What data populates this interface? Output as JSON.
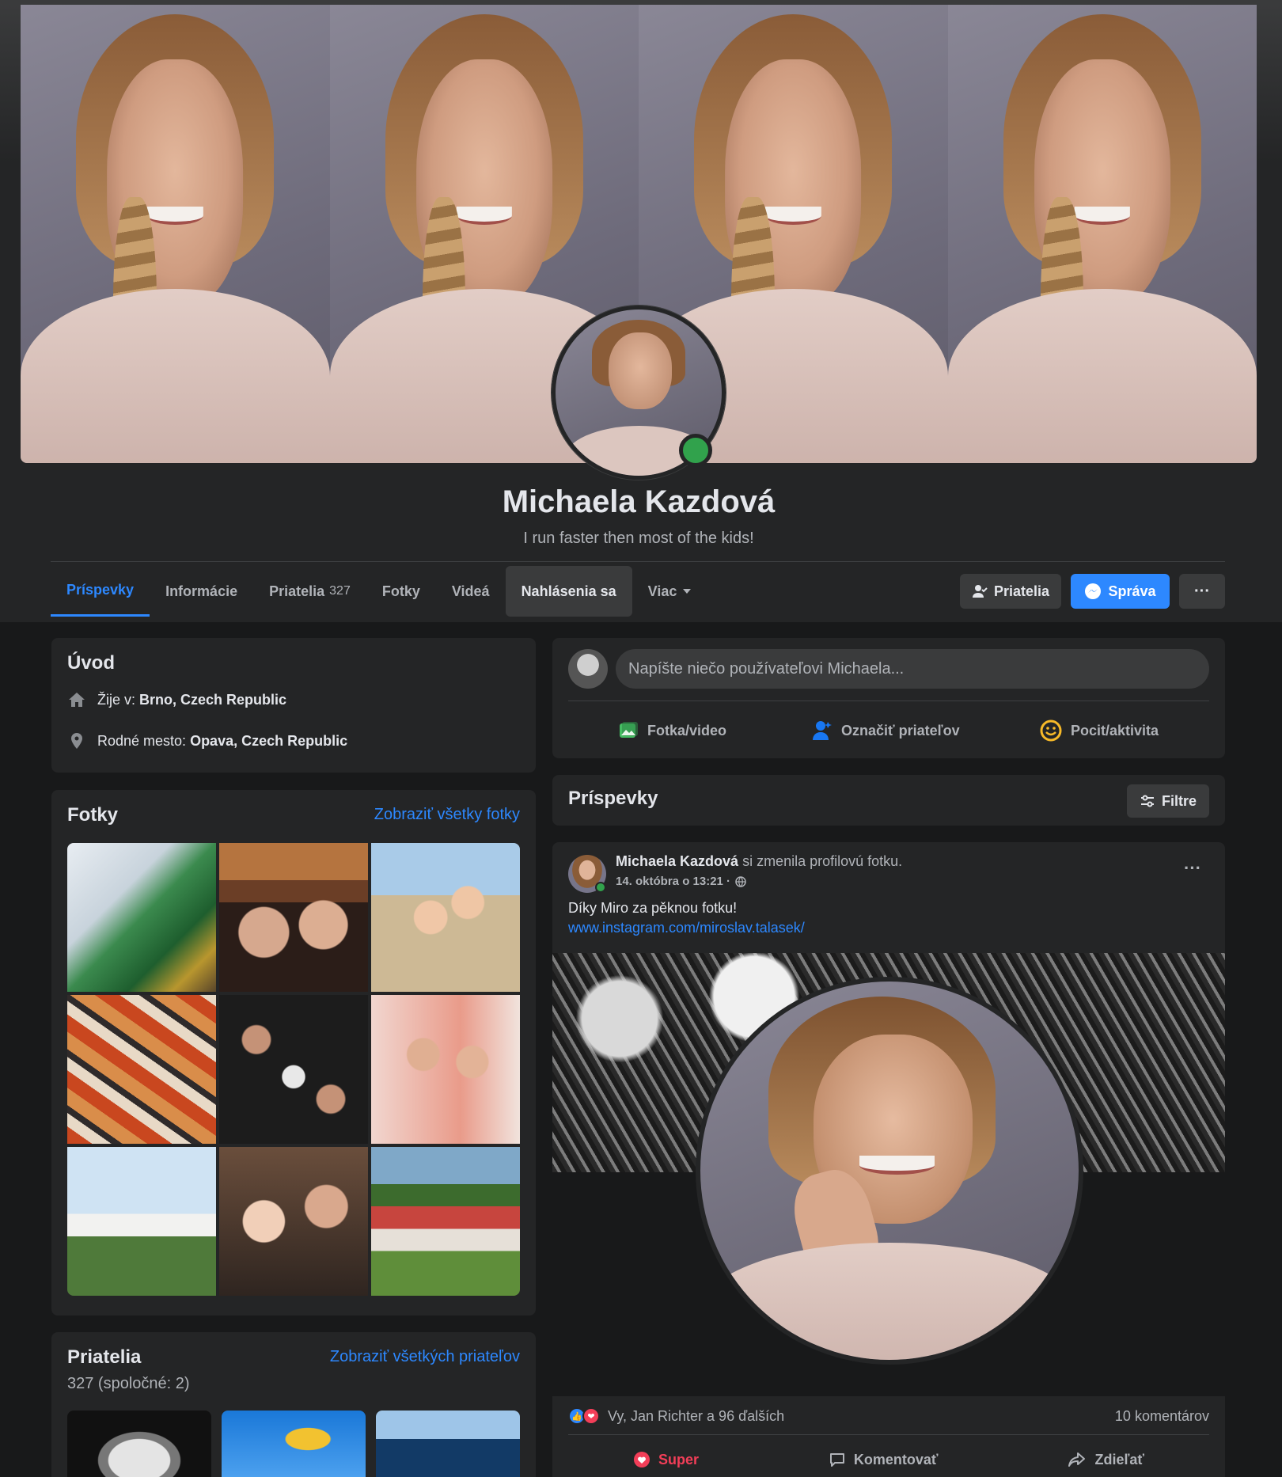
{
  "profile": {
    "name": "Michaela Kazdová",
    "bio": "I run faster then most of the kids!"
  },
  "tabs": [
    {
      "label": "Príspevky",
      "active": true
    },
    {
      "label": "Informácie"
    },
    {
      "label": "Priatelia",
      "count": "327"
    },
    {
      "label": "Fotky"
    },
    {
      "label": "Videá"
    },
    {
      "label": "Nahlásenia sa",
      "highlight": true
    },
    {
      "label": "Viac"
    }
  ],
  "header_buttons": {
    "friends": "Priatelia",
    "message": "Správa",
    "more": "···"
  },
  "intro": {
    "title": "Úvod",
    "lives_prefix": "Žije v: ",
    "lives": "Brno, Czech Republic",
    "hometown_prefix": "Rodné mesto: ",
    "hometown": "Opava, Czech Republic"
  },
  "photos": {
    "title": "Fotky",
    "see_all": "Zobraziť všetky fotky"
  },
  "friends": {
    "title": "Priatelia",
    "see_all": "Zobraziť všetkých priateľov",
    "count_text": "327 (spoločné: 2)"
  },
  "composer": {
    "placeholder": "Napíšte niečo používateľovi Michaela...",
    "photo_video": "Fotka/video",
    "tag_friends": "Označiť priateľov",
    "feeling": "Pocit/aktivita"
  },
  "posts_header": {
    "title": "Príspevky",
    "filter": "Filtre"
  },
  "post": {
    "author": "Michaela Kazdová",
    "action": " si zmenila profilovú fotku.",
    "time": "14. októbra o 13:21 ·",
    "text": "Díky Miro za pěknou fotku!",
    "link": "www.instagram.com/miroslav.talasek/",
    "reactions_text": "Vy, Jan Richter a 96 ďalších",
    "comments_text": "10 komentárov",
    "btn_super": "Super",
    "btn_comment": "Komentovať",
    "btn_share": "Zdieľať"
  },
  "colors": {
    "accent": "#2d88ff",
    "online": "#31a24c",
    "love": "#f33e58",
    "card": "#242526",
    "background": "#18191a"
  }
}
